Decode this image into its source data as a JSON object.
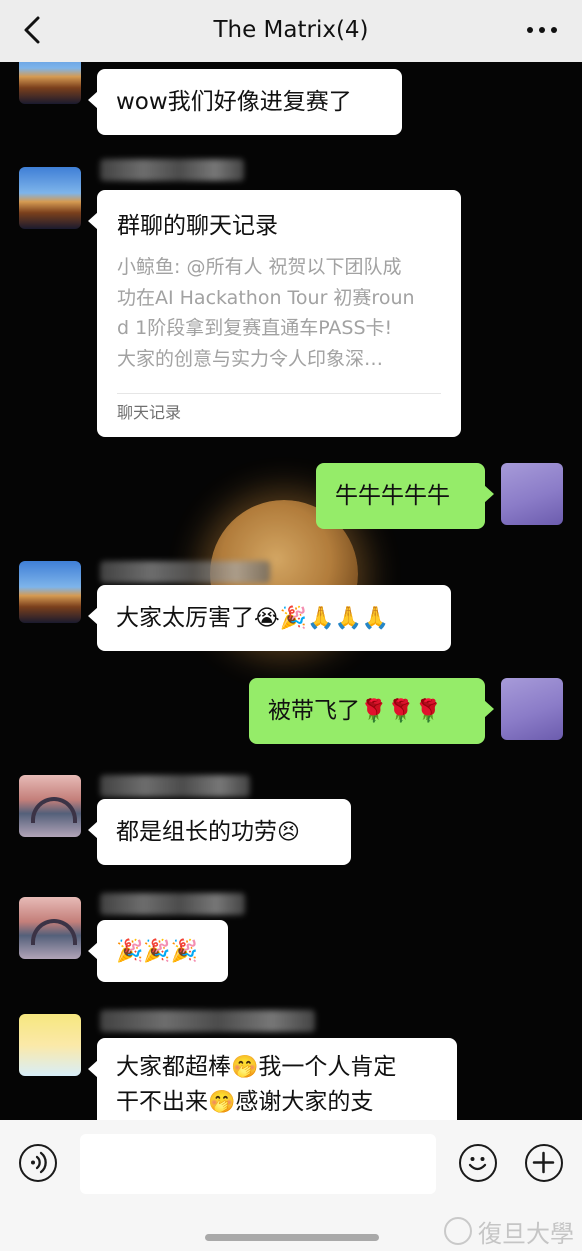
{
  "header": {
    "title": "The Matrix(4)"
  },
  "messages": [
    {
      "text": "wow我们好像进复赛了"
    },
    {
      "card": {
        "title": "群聊的聊天记录",
        "preview_lines": [
          "小鲸鱼: @所有人 祝贺以下团队成",
          "功在AI Hackathon Tour 初赛roun",
          "d 1阶段拿到复赛直通车PASS卡!",
          "大家的创意与实力令人印象深…"
        ],
        "footer": "聊天记录"
      }
    },
    {
      "text": "牛牛牛牛牛"
    },
    {
      "text": "大家太厉害了",
      "emojis": "😭🎉🙏🙏🙏"
    },
    {
      "text": "被带飞了",
      "emojis": "🌹🌹🌹"
    },
    {
      "text": "都是组长的功劳",
      "emojis": "😣"
    },
    {
      "emojis": "🎉🎉🎉"
    },
    {
      "line1": "大家都超棒",
      "e1": "🤭",
      "line1b": "我一个人肯定",
      "line2": "干不出来",
      "e2": "🤭",
      "line2b": "感谢大家的支"
    }
  ],
  "watermark": {
    "text": "復旦大學"
  },
  "colors": {
    "header_bg": "#ededed",
    "own_bubble": "#95ec69",
    "other_bubble": "#ffffff",
    "chat_bg": "#050505"
  }
}
